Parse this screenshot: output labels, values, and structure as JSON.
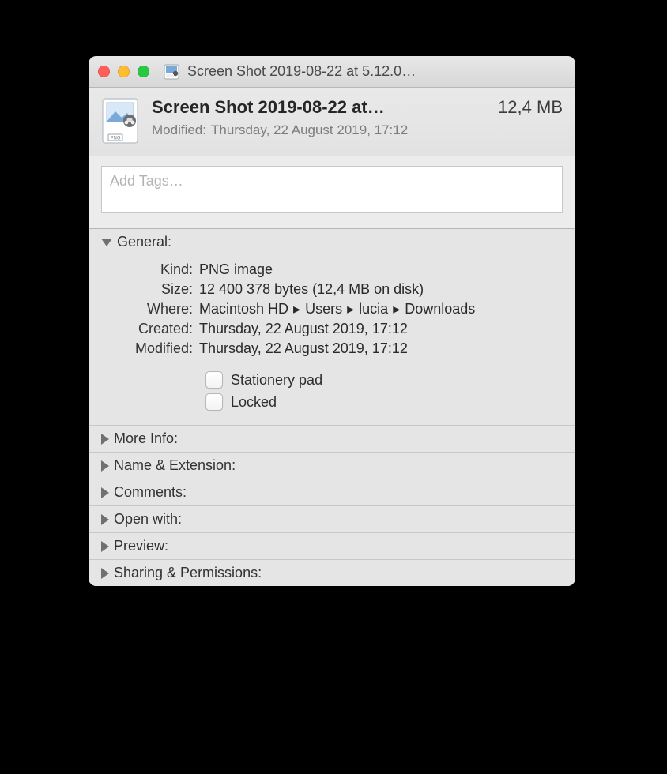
{
  "titlebar": {
    "title": "Screen Shot 2019-08-22 at 5.12.0…"
  },
  "header": {
    "file_title": "Screen Shot 2019-08-22 at…",
    "file_size": "12,4 MB",
    "modified_label": "Modified:",
    "modified_value": "Thursday, 22 August 2019, 17:12",
    "png_badge": "PNG"
  },
  "tags": {
    "placeholder": "Add Tags…"
  },
  "sections": {
    "general": {
      "label": "General:",
      "kind_label": "Kind:",
      "kind_value": "PNG image",
      "size_label": "Size:",
      "size_value": "12 400 378 bytes (12,4 MB on disk)",
      "where_label": "Where:",
      "where_parts": [
        "Macintosh HD",
        "Users",
        "lucia",
        "Downloads"
      ],
      "created_label": "Created:",
      "created_value": "Thursday, 22 August 2019, 17:12",
      "modified2_label": "Modified:",
      "modified2_value": "Thursday, 22 August 2019, 17:12",
      "stationery_label": "Stationery pad",
      "locked_label": "Locked"
    },
    "more_info": "More Info:",
    "name_ext": "Name & Extension:",
    "comments": "Comments:",
    "open_with": "Open with:",
    "preview": "Preview:",
    "sharing": "Sharing & Permissions:"
  }
}
